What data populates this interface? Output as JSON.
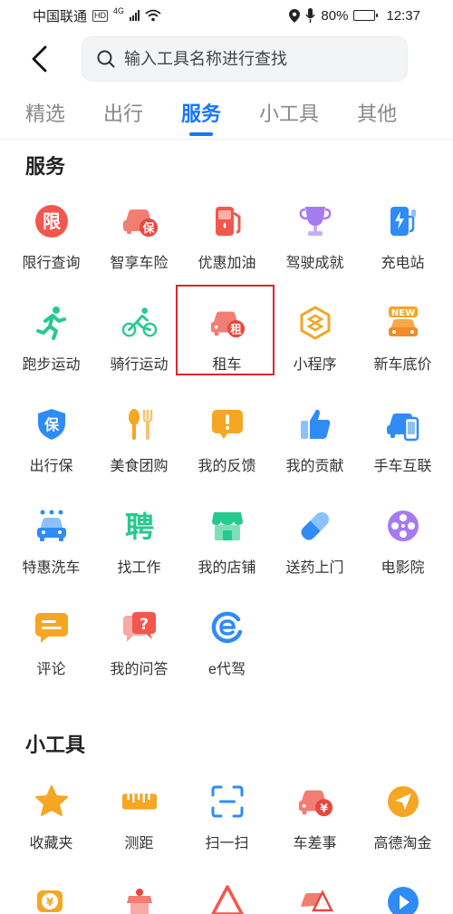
{
  "status_bar": {
    "carrier": "中国联通",
    "hd": "HD",
    "network": "4G",
    "battery": "80%",
    "battery_level": 0.8,
    "time": "12:37"
  },
  "search": {
    "placeholder": "输入工具名称进行查找"
  },
  "tabs": [
    {
      "label": "精选",
      "active": false
    },
    {
      "label": "出行",
      "active": false
    },
    {
      "label": "服务",
      "active": true
    },
    {
      "label": "小工具",
      "active": false
    },
    {
      "label": "其他",
      "active": false
    }
  ],
  "services": {
    "title": "服务",
    "items": [
      {
        "label": "限行查询",
        "icon": "restriction-icon"
      },
      {
        "label": "智享车险",
        "icon": "car-insurance-icon"
      },
      {
        "label": "优惠加油",
        "icon": "fuel-icon"
      },
      {
        "label": "驾驶成就",
        "icon": "trophy-icon"
      },
      {
        "label": "充电站",
        "icon": "charging-icon"
      },
      {
        "label": "跑步运动",
        "icon": "running-icon"
      },
      {
        "label": "骑行运动",
        "icon": "cycling-icon"
      },
      {
        "label": "租车",
        "icon": "car-rental-icon"
      },
      {
        "label": "小程序",
        "icon": "mini-program-icon"
      },
      {
        "label": "新车底价",
        "icon": "new-car-icon"
      },
      {
        "label": "出行保",
        "icon": "travel-insurance-icon"
      },
      {
        "label": "美食团购",
        "icon": "food-icon"
      },
      {
        "label": "我的反馈",
        "icon": "feedback-icon"
      },
      {
        "label": "我的贡献",
        "icon": "thumb-up-icon"
      },
      {
        "label": "手车互联",
        "icon": "phone-car-icon"
      },
      {
        "label": "特惠洗车",
        "icon": "car-wash-icon"
      },
      {
        "label": "找工作",
        "icon": "job-icon"
      },
      {
        "label": "我的店铺",
        "icon": "store-icon"
      },
      {
        "label": "送药上门",
        "icon": "medicine-icon"
      },
      {
        "label": "电影院",
        "icon": "cinema-icon"
      },
      {
        "label": "评论",
        "icon": "comment-icon"
      },
      {
        "label": "我的问答",
        "icon": "qa-icon"
      },
      {
        "label": "e代驾",
        "icon": "e-driver-icon"
      }
    ],
    "highlighted": "租车"
  },
  "tools": {
    "title": "小工具",
    "items": [
      {
        "label": "收藏夹",
        "icon": "star-icon"
      },
      {
        "label": "测距",
        "icon": "ruler-icon"
      },
      {
        "label": "扫一扫",
        "icon": "scan-icon"
      },
      {
        "label": "车差事",
        "icon": "car-errand-icon"
      },
      {
        "label": "高德淘金",
        "icon": "send-icon"
      }
    ]
  },
  "glyphs": {
    "restriction": "限",
    "insurance": "保",
    "rental": "租",
    "new": "NEW",
    "job": "聘",
    "currency": "¥",
    "e_letter": "e",
    "question": "?",
    "exclaim": "!"
  },
  "colors": {
    "accent": "#1677ff",
    "highlight_border": "#d8272f"
  }
}
